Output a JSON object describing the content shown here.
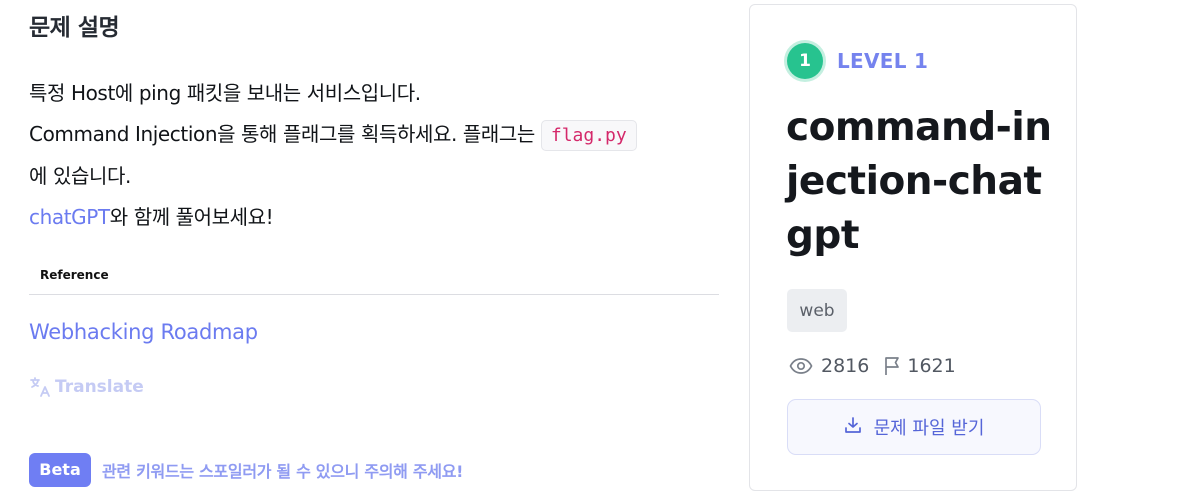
{
  "section_title": "문제 설명",
  "description": {
    "line1": "특정 Host에 ping 패킷을 보내는 서비스입니다.",
    "line2_before": "Command Injection을 통해 플래그를 획득하세요. 플래그는",
    "line2_code": "flag.py",
    "line3": "에 있습니다.",
    "line4_link": "chatGPT",
    "line4_rest": "와 함께 풀어보세요!"
  },
  "reference": {
    "label": "Reference",
    "link": "Webhacking Roadmap"
  },
  "translate": {
    "label": "Translate",
    "icon": "translate-icon"
  },
  "beta": {
    "badge": "Beta",
    "message": "관련 키워드는 스포일러가 될 수 있으니 주의해 주세요!"
  },
  "challenge": {
    "level_number": "1",
    "level_label": "LEVEL 1",
    "title": "command-injection-chatgpt",
    "tag": "web",
    "views": "2816",
    "solves": "1621",
    "download_label": "문제 파일 받기",
    "icons": [
      "eye-icon",
      "flag-icon",
      "download-icon"
    ]
  },
  "colors": {
    "accent": "#6b7bf0",
    "level_green": "#27c38f",
    "code_pink": "#d4286a",
    "beta_bg": "#6f7ef3"
  }
}
